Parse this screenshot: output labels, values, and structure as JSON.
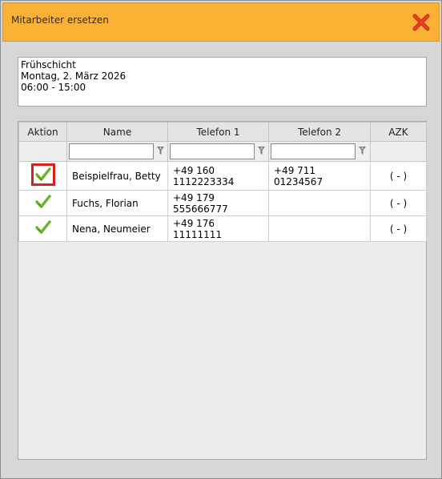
{
  "dialog": {
    "title": "Mitarbeiter ersetzen",
    "accent_color": "#fbb234",
    "close_icon": "close-icon"
  },
  "shift": {
    "name": "Frühschicht",
    "date": "Montag, 2. März 2026",
    "time": "06:00 - 15:00"
  },
  "table": {
    "columns": [
      "Aktion",
      "Name",
      "Telefon 1",
      "Telefon 2",
      "AZK"
    ],
    "filter_icon": "filter-icon",
    "rows": [
      {
        "name": "Beispielfrau, Betty",
        "phone1_line1": "+49 160",
        "phone1_line2": "1112223334",
        "phone2": "+49 711 01234567",
        "azk": "( - )",
        "selected": true
      },
      {
        "name": "Fuchs, Florian",
        "phone1_line1": "+49 179 555666777",
        "phone1_line2": "",
        "phone2": "",
        "azk": "( - )",
        "selected": false
      },
      {
        "name": "Nena, Neumeier",
        "phone1_line1": "+49 176 11111111",
        "phone1_line2": "",
        "phone2": "",
        "azk": "( - )",
        "selected": false
      }
    ]
  }
}
